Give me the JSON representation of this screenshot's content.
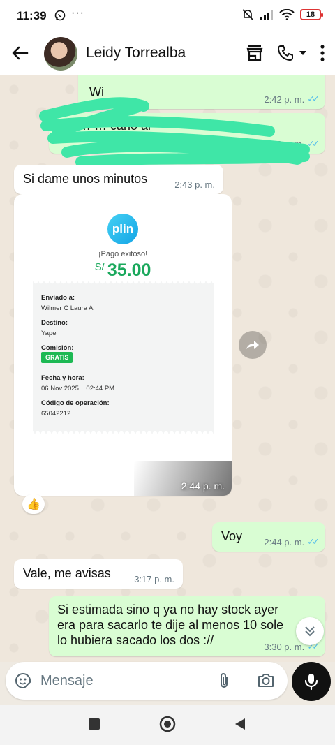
{
  "status_bar": {
    "time": "11:39",
    "dots": "···",
    "battery": "18"
  },
  "header": {
    "contact_name": "Leidy Torrealba"
  },
  "colors": {
    "outgoing_bubble": "#d9fdd3",
    "incoming_bubble": "#ffffff",
    "read_ticks": "#53bdeb",
    "accent_green": "#1aa85c"
  },
  "messages": [
    {
      "id": "m1",
      "direction": "out",
      "text": "Wi",
      "time": "2:42 p. m.",
      "status": "read"
    },
    {
      "id": "m2",
      "direction": "out",
      "text": "me … … carlo al",
      "time": "2:42 p. m.",
      "status": "read"
    },
    {
      "id": "m3",
      "direction": "in",
      "text": "Si dame unos minutos",
      "time": "2:43 p. m."
    },
    {
      "id": "m4",
      "direction": "in",
      "type": "image",
      "time": "2:44 p. m.",
      "reaction": "👍"
    },
    {
      "id": "m5",
      "direction": "out",
      "text": "Voy",
      "time": "2:44 p. m.",
      "status": "read"
    },
    {
      "id": "m6",
      "direction": "in",
      "text": "Vale, me avisas",
      "time": "3:17 p. m."
    },
    {
      "id": "m7",
      "direction": "out",
      "lines": [
        "Si estimada sino q ya no hay stock ayer",
        "era para sacarlo te dije al menos 10 sole",
        "lo hubiera sacado los dos ://"
      ],
      "time": "3:30 p. m.",
      "status": "read"
    }
  ],
  "receipt": {
    "brand": "plin",
    "status": "¡Pago exitoso!",
    "currency": "S/",
    "amount": "35.00",
    "fields": [
      {
        "label": "Enviado a:",
        "value": "Wilmer C Laura A"
      },
      {
        "label": "Destino:",
        "value": "Yape"
      },
      {
        "label": "Comisión:",
        "value": "GRATIS"
      },
      {
        "label": "Fecha y hora:",
        "value": "06 Nov 2025    02:44 PM"
      },
      {
        "label": "Código de operación:",
        "value": "65042212"
      }
    ]
  },
  "composer": {
    "placeholder": "Mensaje"
  }
}
